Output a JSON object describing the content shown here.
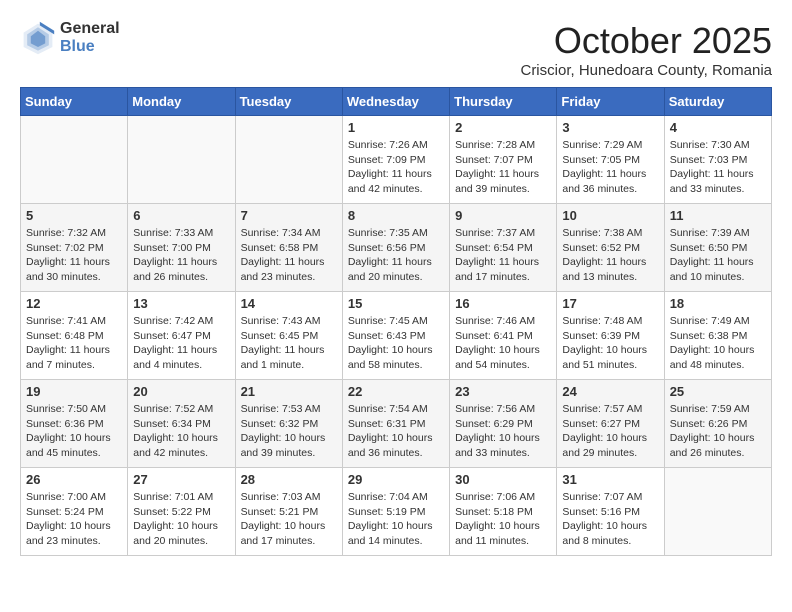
{
  "header": {
    "logo_general": "General",
    "logo_blue": "Blue",
    "title": "October 2025",
    "subtitle": "Criscior, Hunedoara County, Romania"
  },
  "days_of_week": [
    "Sunday",
    "Monday",
    "Tuesday",
    "Wednesday",
    "Thursday",
    "Friday",
    "Saturday"
  ],
  "weeks": [
    [
      {
        "day": "",
        "info": ""
      },
      {
        "day": "",
        "info": ""
      },
      {
        "day": "",
        "info": ""
      },
      {
        "day": "1",
        "info": "Sunrise: 7:26 AM\nSunset: 7:09 PM\nDaylight: 11 hours\nand 42 minutes."
      },
      {
        "day": "2",
        "info": "Sunrise: 7:28 AM\nSunset: 7:07 PM\nDaylight: 11 hours\nand 39 minutes."
      },
      {
        "day": "3",
        "info": "Sunrise: 7:29 AM\nSunset: 7:05 PM\nDaylight: 11 hours\nand 36 minutes."
      },
      {
        "day": "4",
        "info": "Sunrise: 7:30 AM\nSunset: 7:03 PM\nDaylight: 11 hours\nand 33 minutes."
      }
    ],
    [
      {
        "day": "5",
        "info": "Sunrise: 7:32 AM\nSunset: 7:02 PM\nDaylight: 11 hours\nand 30 minutes."
      },
      {
        "day": "6",
        "info": "Sunrise: 7:33 AM\nSunset: 7:00 PM\nDaylight: 11 hours\nand 26 minutes."
      },
      {
        "day": "7",
        "info": "Sunrise: 7:34 AM\nSunset: 6:58 PM\nDaylight: 11 hours\nand 23 minutes."
      },
      {
        "day": "8",
        "info": "Sunrise: 7:35 AM\nSunset: 6:56 PM\nDaylight: 11 hours\nand 20 minutes."
      },
      {
        "day": "9",
        "info": "Sunrise: 7:37 AM\nSunset: 6:54 PM\nDaylight: 11 hours\nand 17 minutes."
      },
      {
        "day": "10",
        "info": "Sunrise: 7:38 AM\nSunset: 6:52 PM\nDaylight: 11 hours\nand 13 minutes."
      },
      {
        "day": "11",
        "info": "Sunrise: 7:39 AM\nSunset: 6:50 PM\nDaylight: 11 hours\nand 10 minutes."
      }
    ],
    [
      {
        "day": "12",
        "info": "Sunrise: 7:41 AM\nSunset: 6:48 PM\nDaylight: 11 hours\nand 7 minutes."
      },
      {
        "day": "13",
        "info": "Sunrise: 7:42 AM\nSunset: 6:47 PM\nDaylight: 11 hours\nand 4 minutes."
      },
      {
        "day": "14",
        "info": "Sunrise: 7:43 AM\nSunset: 6:45 PM\nDaylight: 11 hours\nand 1 minute."
      },
      {
        "day": "15",
        "info": "Sunrise: 7:45 AM\nSunset: 6:43 PM\nDaylight: 10 hours\nand 58 minutes."
      },
      {
        "day": "16",
        "info": "Sunrise: 7:46 AM\nSunset: 6:41 PM\nDaylight: 10 hours\nand 54 minutes."
      },
      {
        "day": "17",
        "info": "Sunrise: 7:48 AM\nSunset: 6:39 PM\nDaylight: 10 hours\nand 51 minutes."
      },
      {
        "day": "18",
        "info": "Sunrise: 7:49 AM\nSunset: 6:38 PM\nDaylight: 10 hours\nand 48 minutes."
      }
    ],
    [
      {
        "day": "19",
        "info": "Sunrise: 7:50 AM\nSunset: 6:36 PM\nDaylight: 10 hours\nand 45 minutes."
      },
      {
        "day": "20",
        "info": "Sunrise: 7:52 AM\nSunset: 6:34 PM\nDaylight: 10 hours\nand 42 minutes."
      },
      {
        "day": "21",
        "info": "Sunrise: 7:53 AM\nSunset: 6:32 PM\nDaylight: 10 hours\nand 39 minutes."
      },
      {
        "day": "22",
        "info": "Sunrise: 7:54 AM\nSunset: 6:31 PM\nDaylight: 10 hours\nand 36 minutes."
      },
      {
        "day": "23",
        "info": "Sunrise: 7:56 AM\nSunset: 6:29 PM\nDaylight: 10 hours\nand 33 minutes."
      },
      {
        "day": "24",
        "info": "Sunrise: 7:57 AM\nSunset: 6:27 PM\nDaylight: 10 hours\nand 29 minutes."
      },
      {
        "day": "25",
        "info": "Sunrise: 7:59 AM\nSunset: 6:26 PM\nDaylight: 10 hours\nand 26 minutes."
      }
    ],
    [
      {
        "day": "26",
        "info": "Sunrise: 7:00 AM\nSunset: 5:24 PM\nDaylight: 10 hours\nand 23 minutes."
      },
      {
        "day": "27",
        "info": "Sunrise: 7:01 AM\nSunset: 5:22 PM\nDaylight: 10 hours\nand 20 minutes."
      },
      {
        "day": "28",
        "info": "Sunrise: 7:03 AM\nSunset: 5:21 PM\nDaylight: 10 hours\nand 17 minutes."
      },
      {
        "day": "29",
        "info": "Sunrise: 7:04 AM\nSunset: 5:19 PM\nDaylight: 10 hours\nand 14 minutes."
      },
      {
        "day": "30",
        "info": "Sunrise: 7:06 AM\nSunset: 5:18 PM\nDaylight: 10 hours\nand 11 minutes."
      },
      {
        "day": "31",
        "info": "Sunrise: 7:07 AM\nSunset: 5:16 PM\nDaylight: 10 hours\nand 8 minutes."
      },
      {
        "day": "",
        "info": ""
      }
    ]
  ]
}
